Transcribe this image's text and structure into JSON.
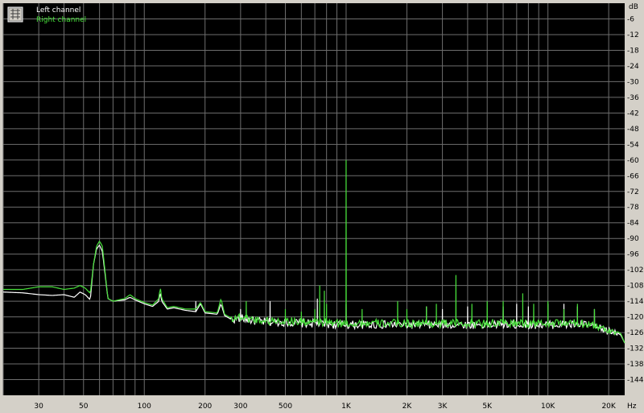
{
  "chart_data": {
    "type": "line",
    "x_scale": "log",
    "xlim": [
      20,
      24000
    ],
    "ylim": [
      -144,
      -6
    ],
    "y_unit": "dB",
    "x_unit": "Hz",
    "x_ticks": [
      {
        "value": 30,
        "label": "30"
      },
      {
        "value": 50,
        "label": "50"
      },
      {
        "value": 100,
        "label": "100"
      },
      {
        "value": 200,
        "label": "200"
      },
      {
        "value": 300,
        "label": "300"
      },
      {
        "value": 500,
        "label": "500"
      },
      {
        "value": 1000,
        "label": "1K"
      },
      {
        "value": 2000,
        "label": "2K"
      },
      {
        "value": 3000,
        "label": "3K"
      },
      {
        "value": 5000,
        "label": "5K"
      },
      {
        "value": 10000,
        "label": "10K"
      },
      {
        "value": 20000,
        "label": "20K"
      }
    ],
    "y_ticks": [
      -6,
      -12,
      -18,
      -24,
      -30,
      -36,
      -42,
      -48,
      -54,
      -60,
      -66,
      -72,
      -78,
      -84,
      -90,
      -96,
      -102,
      -108,
      -114,
      -120,
      -126,
      -132,
      -138,
      -144
    ],
    "grid": true,
    "legend_position": "top-left",
    "background_color": "#000000",
    "grid_color": "#6e6e6e",
    "series": [
      {
        "name": "Left channel",
        "color": "#ffffff",
        "points": [
          [
            20,
            -110.5
          ],
          [
            25,
            -110.8
          ],
          [
            30,
            -111.5
          ],
          [
            35,
            -111.8
          ],
          [
            40,
            -111.5
          ],
          [
            45,
            -112.5
          ],
          [
            48,
            -110.5
          ],
          [
            51,
            -111.5
          ],
          [
            54,
            -113.5
          ],
          [
            56,
            -100
          ],
          [
            58,
            -94
          ],
          [
            60,
            -92.5
          ],
          [
            62,
            -95
          ],
          [
            64,
            -104
          ],
          [
            66,
            -113
          ],
          [
            70,
            -114
          ],
          [
            80,
            -113.5
          ],
          [
            85,
            -112.5
          ],
          [
            90,
            -113.5
          ],
          [
            100,
            -115
          ],
          [
            110,
            -116
          ],
          [
            118,
            -114
          ],
          [
            120,
            -110.5
          ],
          [
            122,
            -114
          ],
          [
            130,
            -117
          ],
          [
            140,
            -116.5
          ],
          [
            160,
            -117.5
          ],
          [
            180,
            -118
          ],
          [
            190,
            -115
          ],
          [
            200,
            -118.5
          ],
          [
            230,
            -119
          ],
          [
            240,
            -115
          ],
          [
            250,
            -119.5
          ],
          [
            270,
            -121
          ],
          [
            300,
            -120.5
          ],
          [
            350,
            -121.5
          ],
          [
            400,
            -122
          ],
          [
            500,
            -122
          ],
          [
            600,
            -122.5
          ],
          [
            700,
            -122.5
          ],
          [
            900,
            -123
          ],
          [
            1200,
            -123
          ],
          [
            1500,
            -123
          ],
          [
            2000,
            -123
          ],
          [
            3000,
            -123
          ],
          [
            5000,
            -123
          ],
          [
            8000,
            -123
          ],
          [
            12000,
            -123
          ],
          [
            16000,
            -123
          ],
          [
            18000,
            -124.5
          ],
          [
            20000,
            -125.5
          ],
          [
            22000,
            -126
          ],
          [
            23000,
            -127
          ],
          [
            24000,
            -130
          ]
        ],
        "spikes": [
          [
            180,
            -114
          ],
          [
            300,
            -117
          ],
          [
            420,
            -114
          ],
          [
            720,
            -113
          ],
          [
            1000,
            -115
          ],
          [
            2500,
            -116
          ],
          [
            3000,
            -117
          ],
          [
            4000,
            -116
          ],
          [
            6000,
            -116
          ],
          [
            7000,
            -115
          ],
          [
            8000,
            -116
          ],
          [
            10000,
            -115
          ],
          [
            12000,
            -115
          ],
          [
            14000,
            -116
          ],
          [
            17000,
            -117
          ]
        ]
      },
      {
        "name": "Right channel",
        "color": "#47e03a",
        "points": [
          [
            20,
            -109.5
          ],
          [
            25,
            -109.5
          ],
          [
            30,
            -108.5
          ],
          [
            35,
            -108.5
          ],
          [
            40,
            -109.5
          ],
          [
            45,
            -109
          ],
          [
            48,
            -108
          ],
          [
            51,
            -109
          ],
          [
            54,
            -111
          ],
          [
            56,
            -100
          ],
          [
            58,
            -93
          ],
          [
            60,
            -91
          ],
          [
            62,
            -93
          ],
          [
            64,
            -103
          ],
          [
            66,
            -113
          ],
          [
            70,
            -114
          ],
          [
            80,
            -113
          ],
          [
            85,
            -111.5
          ],
          [
            90,
            -113
          ],
          [
            100,
            -114.5
          ],
          [
            110,
            -115.5
          ],
          [
            118,
            -113
          ],
          [
            120,
            -108.5
          ],
          [
            122,
            -113
          ],
          [
            130,
            -116.5
          ],
          [
            140,
            -116
          ],
          [
            160,
            -117
          ],
          [
            180,
            -117
          ],
          [
            190,
            -114.5
          ],
          [
            200,
            -118
          ],
          [
            230,
            -118.5
          ],
          [
            240,
            -113
          ],
          [
            250,
            -119
          ],
          [
            270,
            -120.5
          ],
          [
            300,
            -120
          ],
          [
            350,
            -121
          ],
          [
            400,
            -121.5
          ],
          [
            500,
            -121.5
          ],
          [
            600,
            -122
          ],
          [
            700,
            -122
          ],
          [
            900,
            -122.5
          ],
          [
            1200,
            -122.5
          ],
          [
            1500,
            -122.5
          ],
          [
            2000,
            -122.5
          ],
          [
            3000,
            -122.5
          ],
          [
            5000,
            -122.5
          ],
          [
            8000,
            -122.5
          ],
          [
            12000,
            -122.5
          ],
          [
            16000,
            -122.5
          ],
          [
            18000,
            -124
          ],
          [
            20000,
            -125
          ],
          [
            22000,
            -125.5
          ],
          [
            23000,
            -126.5
          ],
          [
            24000,
            -130
          ]
        ],
        "spikes": [
          [
            320,
            -114
          ],
          [
            500,
            -117
          ],
          [
            600,
            -118
          ],
          [
            700,
            -117
          ],
          [
            740,
            -108
          ],
          [
            780,
            -110
          ],
          [
            800,
            -115
          ],
          [
            1000,
            -60
          ],
          [
            1200,
            -117
          ],
          [
            1800,
            -114
          ],
          [
            2000,
            -117
          ],
          [
            2500,
            -116
          ],
          [
            2800,
            -115
          ],
          [
            3500,
            -104
          ],
          [
            4200,
            -115
          ],
          [
            5000,
            -114
          ],
          [
            6000,
            -114
          ],
          [
            7500,
            -111
          ],
          [
            8500,
            -115
          ],
          [
            10000,
            -114
          ],
          [
            12000,
            -117
          ],
          [
            14000,
            -115
          ],
          [
            17000,
            -117
          ]
        ]
      }
    ]
  }
}
